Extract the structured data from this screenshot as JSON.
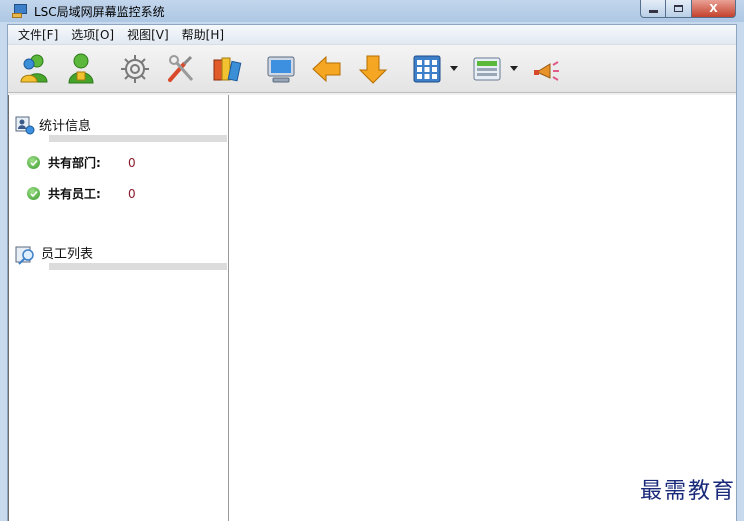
{
  "window": {
    "title": "LSC局域网屏幕监控系统",
    "controls": {
      "minimize_icon": "minimize-icon",
      "maximize_icon": "maximize-icon",
      "close_label": "X"
    }
  },
  "menu": {
    "items": [
      {
        "label": "文件[F]"
      },
      {
        "label": "选项[O]"
      },
      {
        "label": "视图[V]"
      },
      {
        "label": "帮助[H]"
      }
    ]
  },
  "toolbar": {
    "buttons": [
      {
        "icon": "add-user-icon"
      },
      {
        "icon": "user-icon"
      },
      {
        "icon": "gear-icon"
      },
      {
        "icon": "tools-icon"
      },
      {
        "icon": "books-icon"
      },
      {
        "icon": "monitor-icon"
      },
      {
        "icon": "arrow-left-icon"
      },
      {
        "icon": "arrow-down-icon"
      },
      {
        "icon": "grid-view-icon",
        "has_dropdown": true
      },
      {
        "icon": "switch-icon",
        "has_dropdown": true
      },
      {
        "icon": "broadcast-icon"
      }
    ]
  },
  "sidebar": {
    "stats_section": {
      "title": "统计信息",
      "items": [
        {
          "label": "共有部门:",
          "value": "0"
        },
        {
          "label": "共有员工:",
          "value": "0"
        }
      ]
    },
    "employee_section": {
      "title": "员工列表"
    }
  },
  "watermark": {
    "text": "最需教育"
  },
  "colors": {
    "accent": "#3d7fc8",
    "value_color": "#8b1a2b",
    "close_button": "#c4412c",
    "watermark": "#1a2a7a"
  }
}
